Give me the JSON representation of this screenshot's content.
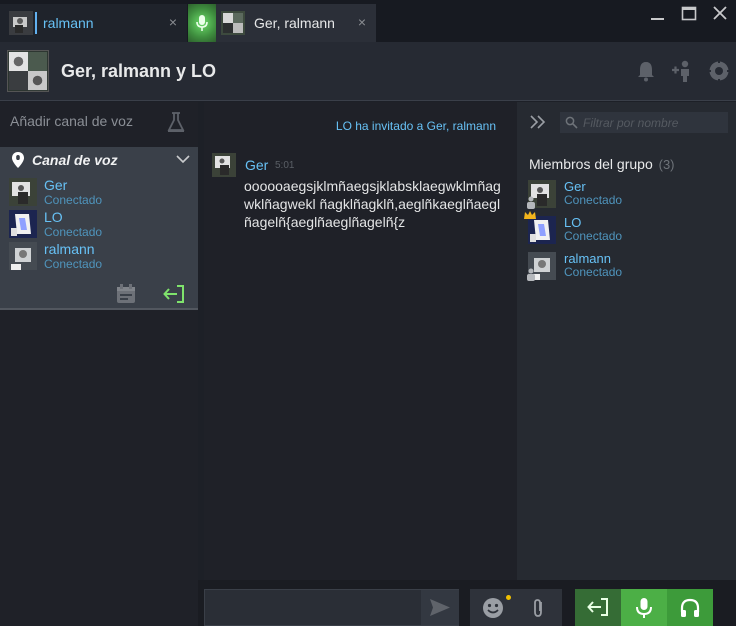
{
  "tabs": [
    {
      "title": "ralmann",
      "close": "×"
    },
    {
      "title": "Ger, ralmann",
      "close": "×"
    }
  ],
  "header": {
    "title": "Ger, ralmann y LO"
  },
  "voice": {
    "add_channel_label": "Añadir canal de voz",
    "channel_name": "Canal de voz",
    "members": [
      {
        "name": "Ger",
        "status": "Conectado"
      },
      {
        "name": "LO",
        "status": "Conectado"
      },
      {
        "name": "ralmann",
        "status": "Conectado"
      }
    ]
  },
  "chat": {
    "invite_text": "LO ha invitado a Ger, ralmann",
    "messages": [
      {
        "author": "Ger",
        "time": "5:01",
        "text": "oooooaegsjklmñaegsjklabsklaegwklmñagwklñagwekl ñagklñagklñ,aeglñkaeglñaeglñagelñ{aeglñaeglñagelñ{z"
      }
    ]
  },
  "members_panel": {
    "filter_placeholder": "Filtrar por nombre",
    "title": "Miembros del grupo",
    "count": "(3)",
    "members": [
      {
        "name": "Ger",
        "status": "Conectado"
      },
      {
        "name": "LO",
        "status": "Conectado"
      },
      {
        "name": "ralmann",
        "status": "Conectado"
      }
    ]
  },
  "composer": {
    "value": ""
  },
  "colors": {
    "accent": "#67c1f5",
    "voice_green": "#4caf46",
    "panel": "#3a4049"
  }
}
